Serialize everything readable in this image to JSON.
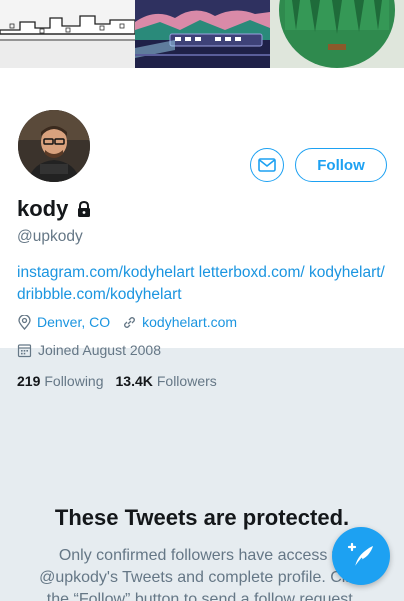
{
  "profile": {
    "display_name": "kody",
    "handle": "@upkody",
    "bio": "instagram.com/kodyhelart letterboxd.com/ kodyhelart/ dribbble.com/kodyhelart",
    "location": "Denver, CO",
    "website": "kodyhelart.com",
    "joined": "Joined August 2008",
    "following_count": "219",
    "following_label": "Following",
    "followers_count": "13.4K",
    "followers_label": "Followers",
    "protected_icon": "lock-icon"
  },
  "actions": {
    "message_icon": "envelope-icon",
    "follow_label": "Follow",
    "compose_icon": "compose-tweet-icon"
  },
  "protected": {
    "title": "These Tweets are protected.",
    "text": "Only confirmed followers have access to @upkody's Tweets and complete profile. Click the “Follow” button to send a follow request."
  },
  "colors": {
    "accent": "#1da1f2",
    "link": "#1b95e0",
    "muted": "#657786",
    "text": "#14171a",
    "background": "#e6ecf0"
  }
}
